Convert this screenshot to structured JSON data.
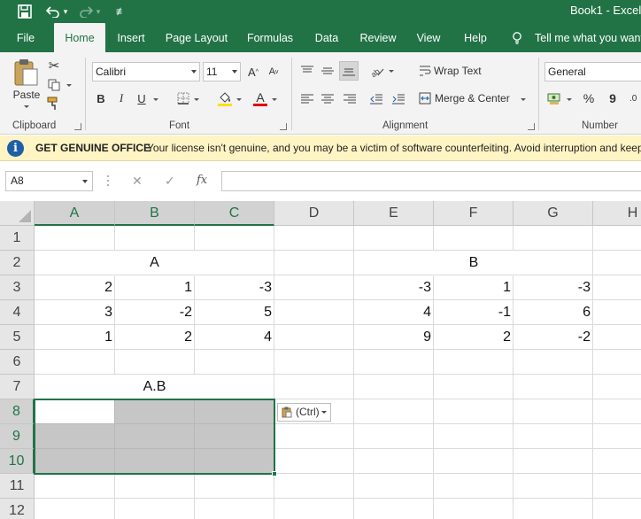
{
  "title_bar": {
    "title": "Book1  -  Excel"
  },
  "tabs": [
    {
      "label": "File"
    },
    {
      "label": "Home"
    },
    {
      "label": "Insert"
    },
    {
      "label": "Page Layout"
    },
    {
      "label": "Formulas"
    },
    {
      "label": "Data"
    },
    {
      "label": "Review"
    },
    {
      "label": "View"
    },
    {
      "label": "Help"
    }
  ],
  "tell_me": "Tell me what you want",
  "ribbon": {
    "clipboard": {
      "paste": "Paste",
      "group": "Clipboard"
    },
    "font": {
      "name": "Calibri",
      "size": "11",
      "bold": "B",
      "italic": "I",
      "underline": "U",
      "grow": "A",
      "shrink": "A",
      "font_color": "A",
      "group": "Font"
    },
    "alignment": {
      "wrap": "Wrap Text",
      "merge": "Merge & Center",
      "group": "Alignment"
    },
    "number": {
      "format": "General",
      "percent": "%",
      "comma": "9",
      "group": "Number"
    }
  },
  "message_bar": {
    "title": "GET GENUINE OFFICE",
    "text": "Your license isn't genuine, and you may be a victim of software counterfeiting. Avoid interruption and keep"
  },
  "formula_bar": {
    "name_box": "A8",
    "cancel": "✕",
    "enter": "✓",
    "fx": "fx",
    "value": ""
  },
  "grid": {
    "columns": [
      "A",
      "B",
      "C",
      "D",
      "E",
      "F",
      "G",
      "H"
    ],
    "rows": [
      "1",
      "2",
      "3",
      "4",
      "5",
      "6",
      "7",
      "8",
      "9",
      "10",
      "11",
      "12"
    ],
    "label_A": "A",
    "label_B": "B",
    "label_AB": "A.B",
    "matrix_A": [
      [
        "2",
        "1",
        "-3"
      ],
      [
        "3",
        "-2",
        "5"
      ],
      [
        "1",
        "2",
        "4"
      ]
    ],
    "matrix_B": [
      [
        "-3",
        "1",
        "-3"
      ],
      [
        "4",
        "-1",
        "6"
      ],
      [
        "9",
        "2",
        "-2"
      ]
    ]
  },
  "paste_options": {
    "label": "(Ctrl)"
  },
  "colors": {
    "excel_green": "#217346",
    "message_bar": "#fff4c3",
    "selection": "#c6c6c6"
  }
}
